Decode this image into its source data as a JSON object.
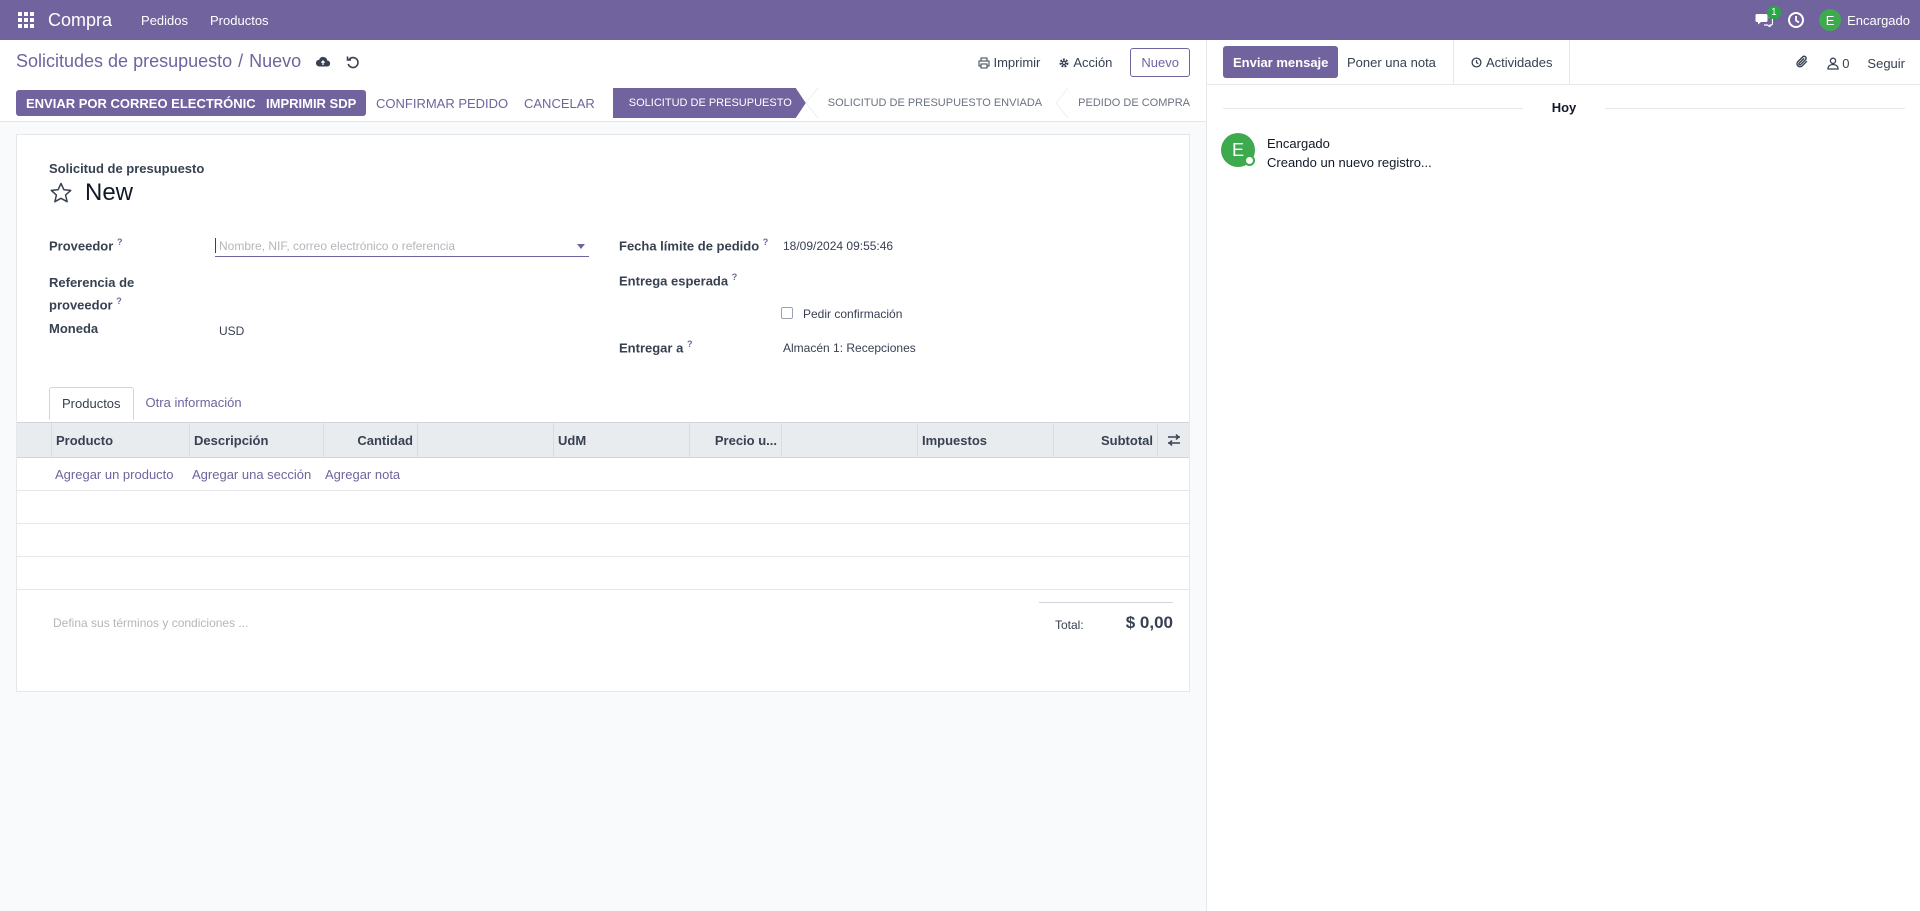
{
  "navbar": {
    "brand": "Compra",
    "menu": [
      "Pedidos",
      "Productos"
    ],
    "chat_count": "1",
    "user_initial": "E",
    "user_name": "Encargado"
  },
  "breadcrumb": {
    "parent": "Solicitudes de presupuesto",
    "separator": "/",
    "current": "Nuevo"
  },
  "top_actions": {
    "print": "Imprimir",
    "action": "Acción",
    "new": "Nuevo"
  },
  "statusbar": {
    "buttons": [
      "ENVIAR POR CORREO ELECTRÓNICO",
      "IMPRIMIR SDP"
    ],
    "links": [
      "CONFIRMAR PEDIDO",
      "CANCELAR"
    ],
    "stages": [
      "SOLICITUD DE PRESUPUESTO",
      "SOLICITUD DE PRESUPUESTO ENVIADA",
      "PEDIDO DE COMPRA"
    ],
    "active_stage": "SOLICITUD DE PRESUPUESTO"
  },
  "form": {
    "doc_type": "Solicitud de presupuesto",
    "name": "New",
    "vendor_label": "Proveedor",
    "vendor_placeholder": "Nombre, NIF, correo electrónico o referencia",
    "vendor_ref_label_1": "Referencia de",
    "vendor_ref_label_2": "proveedor",
    "currency_label": "Moneda",
    "currency_value": "USD",
    "deadline_label": "Fecha límite de pedido",
    "deadline_value": "18/09/2024 09:55:46",
    "expected_label": "Entrega esperada",
    "ask_confirmation": "Pedir confirmación",
    "deliver_to_label": "Entregar a",
    "deliver_to_value": "Almacén 1: Recepciones",
    "help_mark": "?"
  },
  "tabs": [
    "Productos",
    "Otra información"
  ],
  "table": {
    "columns": [
      "Producto",
      "Descripción",
      "Cantidad",
      "UdM",
      "Precio u...",
      "Impuestos",
      "Subtotal"
    ],
    "add_links": [
      "Agregar un producto",
      "Agregar una sección",
      "Agregar nota"
    ]
  },
  "footer": {
    "terms_placeholder": "Defina sus términos y condiciones ...",
    "total_label": "Total:",
    "total_value": "$ 0,00"
  },
  "chatter": {
    "send_message": "Enviar mensaje",
    "log_note": "Poner una nota",
    "activities": "Actividades",
    "followers_count": "0",
    "follow": "Seguir",
    "today": "Hoy",
    "message": {
      "avatar_initial": "E",
      "author": "Encargado",
      "body": "Creando un nuevo registro..."
    }
  },
  "colors": {
    "brand": "#71639e",
    "avatar": "#3daa4e",
    "badge": "#28a745"
  }
}
